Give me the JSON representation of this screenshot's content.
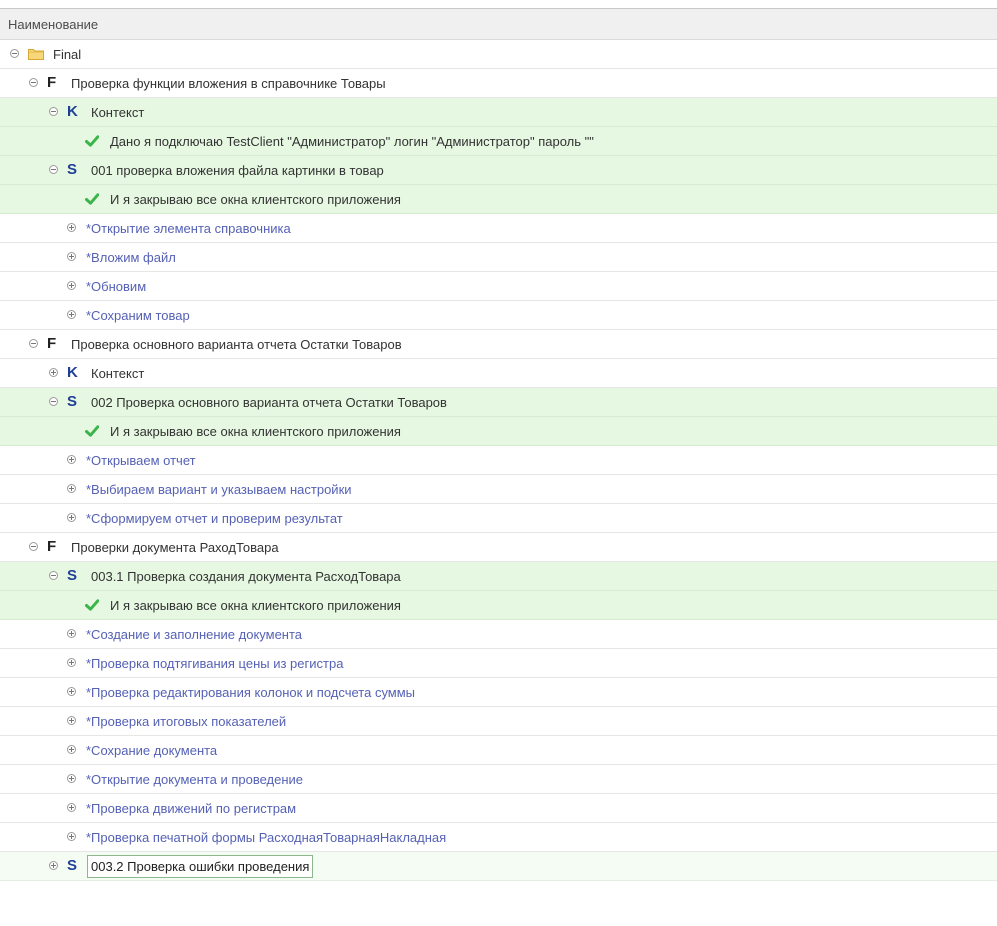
{
  "header": {
    "column_name": "Наименование"
  },
  "colors": {
    "success_row": "#e6f8e2",
    "selected_row": "#f5fcf3",
    "check": "#3bb54a",
    "link": "#5561b5",
    "letter_blue": "#1f3f95"
  },
  "rows": [
    {
      "kind": "folder",
      "level": 0,
      "toggle": "minus",
      "text": "Final"
    },
    {
      "kind": "feature",
      "level": 1,
      "toggle": "minus",
      "letter": "F",
      "text": "Проверка функции вложения в справочнике Товары"
    },
    {
      "kind": "context",
      "level": 2,
      "toggle": "minus",
      "letter": "K",
      "text": "Контекст",
      "state": "green"
    },
    {
      "kind": "step",
      "level": 3,
      "status": "passed",
      "text": "Дано я подключаю TestClient \"Администратор\" логин \"Администратор\" пароль \"\"",
      "state": "green"
    },
    {
      "kind": "scenario",
      "level": 2,
      "toggle": "minus",
      "letter": "S",
      "text": "001 проверка вложения файла картинки в товар",
      "state": "green"
    },
    {
      "kind": "step",
      "level": 3,
      "status": "passed",
      "text": "И я закрываю все окна клиентского приложения",
      "state": "green"
    },
    {
      "kind": "group",
      "level": 3,
      "toggle": "plus",
      "text": "*Открытие элемента справочника"
    },
    {
      "kind": "group",
      "level": 3,
      "toggle": "plus",
      "text": "*Вложим файл"
    },
    {
      "kind": "group",
      "level": 3,
      "toggle": "plus",
      "text": "*Обновим"
    },
    {
      "kind": "group",
      "level": 3,
      "toggle": "plus",
      "text": "*Сохраним товар"
    },
    {
      "kind": "feature",
      "level": 1,
      "toggle": "minus",
      "letter": "F",
      "text": "Проверка основного варианта отчета Остатки Товаров"
    },
    {
      "kind": "context",
      "level": 2,
      "toggle": "plus",
      "letter": "K",
      "text": "Контекст"
    },
    {
      "kind": "scenario",
      "level": 2,
      "toggle": "minus",
      "letter": "S",
      "text": "002 Проверка основного варианта отчета Остатки Товаров",
      "state": "green"
    },
    {
      "kind": "step",
      "level": 3,
      "status": "passed",
      "text": "И я закрываю все окна клиентского приложения",
      "state": "green"
    },
    {
      "kind": "group",
      "level": 3,
      "toggle": "plus",
      "text": "*Открываем отчет"
    },
    {
      "kind": "group",
      "level": 3,
      "toggle": "plus",
      "text": "*Выбираем вариант и указываем настройки"
    },
    {
      "kind": "group",
      "level": 3,
      "toggle": "plus",
      "text": "*Сформируем отчет и проверим результат"
    },
    {
      "kind": "feature",
      "level": 1,
      "toggle": "minus",
      "letter": "F",
      "text": "Проверки документа РаходТовара"
    },
    {
      "kind": "scenario",
      "level": 2,
      "toggle": "minus",
      "letter": "S",
      "text": "003.1 Проверка создания документа РасходТовара",
      "state": "green"
    },
    {
      "kind": "step",
      "level": 3,
      "status": "passed",
      "text": "И я закрываю все окна клиентского приложения",
      "state": "green"
    },
    {
      "kind": "group",
      "level": 3,
      "toggle": "plus",
      "text": "*Создание и заполнение документа"
    },
    {
      "kind": "group",
      "level": 3,
      "toggle": "plus",
      "text": "*Проверка подтягивания цены из регистра"
    },
    {
      "kind": "group",
      "level": 3,
      "toggle": "plus",
      "text": "*Проверка редактирования колонок и подсчета суммы"
    },
    {
      "kind": "group",
      "level": 3,
      "toggle": "plus",
      "text": "*Проверка итоговых показателей"
    },
    {
      "kind": "group",
      "level": 3,
      "toggle": "plus",
      "text": "*Сохрание документа"
    },
    {
      "kind": "group",
      "level": 3,
      "toggle": "plus",
      "text": "*Открытие документа и проведение"
    },
    {
      "kind": "group",
      "level": 3,
      "toggle": "plus",
      "text": "*Проверка движений по регистрам"
    },
    {
      "kind": "group",
      "level": 3,
      "toggle": "plus",
      "text": "*Проверка печатной формы РасходнаяТоварнаяНакладная"
    },
    {
      "kind": "scenario",
      "level": 2,
      "toggle": "plus",
      "letter": "S",
      "text": "003.2 Проверка ошибки проведения",
      "state": "selected"
    }
  ]
}
